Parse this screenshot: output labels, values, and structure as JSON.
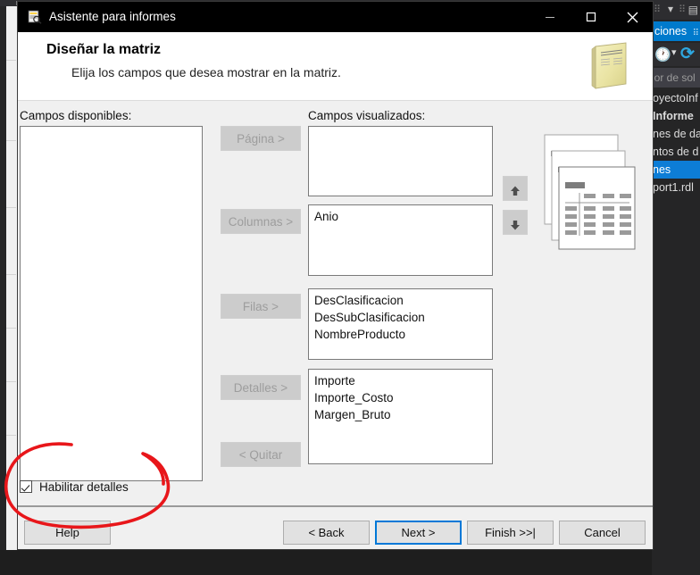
{
  "window": {
    "title": "Asistente para informes",
    "icon": "report-wizard-icon",
    "minimize_label": "Minimizar",
    "maximize_label": "Maximizar",
    "close_label": "Cerrar"
  },
  "header": {
    "title": "Diseñar la matriz",
    "subtitle": "Elija los campos que desea mostrar en la matriz.",
    "graphic": "report-page-icon"
  },
  "panels": {
    "available_label": "Campos disponibles:",
    "displayed_label": "Campos visualizados:",
    "available_items": [],
    "page_items": [],
    "columns_items": [
      "Anio"
    ],
    "rows_items": [
      "DesClasificacion",
      "DesSubClasificacion",
      "NombreProducto"
    ],
    "details_items": [
      "Importe",
      "Importe_Costo",
      "Margen_Bruto"
    ]
  },
  "move_buttons": {
    "page": "Página >",
    "columns": "Columnas >",
    "rows": "Filas >",
    "details": "Detalles >",
    "remove": "< Quitar",
    "up": "move-up",
    "down": "move-down"
  },
  "checkbox": {
    "label": "Habilitar detalles",
    "checked": true
  },
  "footer": {
    "help": "Help",
    "back": "< Back",
    "next": "Next >",
    "finish": "Finish >>|",
    "cancel": "Cancel"
  },
  "solution_explorer": {
    "title": "ciones",
    "search_placeholder": "lor de sol",
    "tree": [
      {
        "label": "oyectoInf",
        "style": "normal"
      },
      {
        "label": "Informe",
        "style": "bold"
      },
      {
        "label": "nes de dat",
        "style": "normal"
      },
      {
        "label": "ntos de d",
        "style": "normal"
      },
      {
        "label": "nes",
        "style": "selected"
      },
      {
        "label": "port1.rdl",
        "style": "normal"
      }
    ]
  },
  "annotation": {
    "shape": "hand-drawn-red-ellipse",
    "color": "#e8161a"
  },
  "colors": {
    "accent_blue": "#0078d7",
    "solution_blue": "#007acc",
    "dialog_bg": "#f0f0f0",
    "titlebar": "#000000",
    "annotation_red": "#e8161a"
  }
}
